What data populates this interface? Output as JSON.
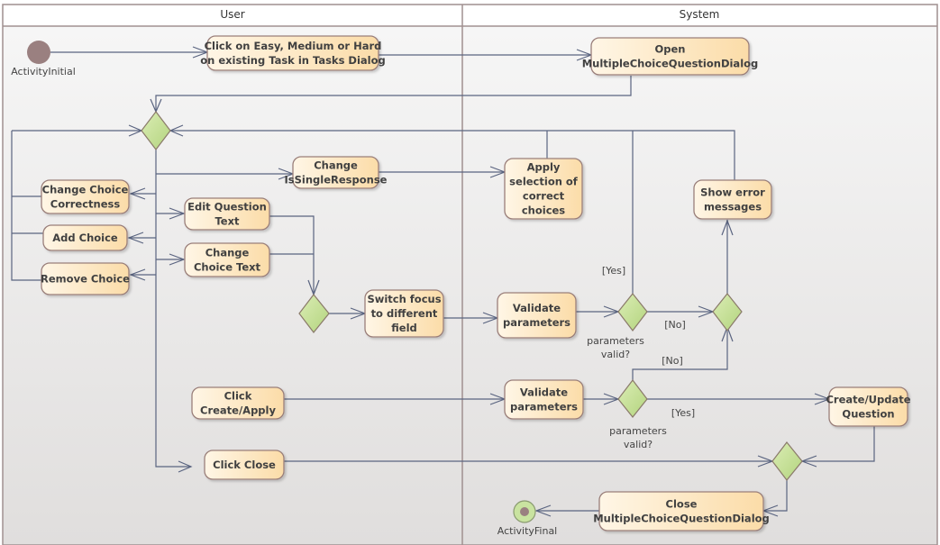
{
  "lanes": {
    "user": "User",
    "system": "System"
  },
  "nodes": {
    "initial": "ActivityInitial",
    "final": "ActivityFinal",
    "click_task": [
      "Click on Easy, Medium or Hard",
      "on existing Task in Tasks Dialog"
    ],
    "open_dialog": [
      "Open",
      "MultipleChoiceQuestionDialog"
    ],
    "change_correctness": [
      "Change Choice",
      "Correctness"
    ],
    "add_choice": [
      "Add Choice"
    ],
    "remove_choice": [
      "Remove Choice"
    ],
    "change_single": [
      "Change",
      "IsSingleResponse"
    ],
    "edit_question": [
      "Edit Question",
      "Text"
    ],
    "change_choice_text": [
      "Change",
      "Choice Text"
    ],
    "switch_focus": [
      "Switch focus",
      "to different",
      "field"
    ],
    "apply_selection": [
      "Apply",
      "selection of",
      "correct",
      "choices"
    ],
    "show_error": [
      "Show error",
      "messages"
    ],
    "validate_1": [
      "Validate",
      "parameters"
    ],
    "validate_2": [
      "Validate",
      "parameters"
    ],
    "click_create": [
      "Click",
      "Create/Apply"
    ],
    "click_close": [
      "Click Close"
    ],
    "create_update": [
      "Create/Update",
      "Question"
    ],
    "close_dialog": [
      "Close",
      "MultipleChoiceQuestionDialog"
    ]
  },
  "guards": {
    "yes_1": "[Yes]",
    "no_1": "[No]",
    "no_2": "[No]",
    "yes_2": "[Yes]",
    "decision_1": [
      "parameters",
      "valid?"
    ],
    "decision_2": [
      "parameters",
      "valid?"
    ]
  },
  "colors": {
    "action_fill_light": "#fff4e0",
    "action_fill_dark": "#fbdfae",
    "decision_fill_light": "#d8ebb0",
    "decision_fill_dark": "#b7d784",
    "edge": "#5a6480",
    "initial": "#9a8080"
  }
}
